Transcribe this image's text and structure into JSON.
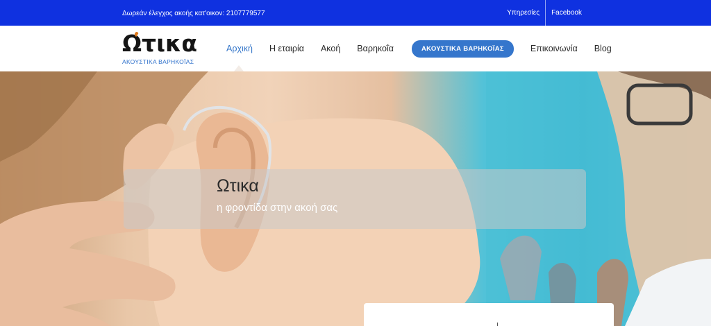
{
  "topbar": {
    "promo": "Δωρεάν έλεγχος ακοής κατ'οικον: 2107779577",
    "links": [
      "Υπηρεσίες",
      "Facebook"
    ]
  },
  "logo": {
    "name": "Ωτικα",
    "subtitle": "ΑΚΟΥΣΤΙΚΑ ΒΑΡΗΚΟΪΑΣ"
  },
  "nav": {
    "items": [
      "Αρχική",
      "Η εταιρία",
      "Ακοή",
      "Βαρηκοΐα"
    ],
    "cta": "ΑΚΟΥΣΤΙΚΑ ΒΑΡΗΚΟΪΑΣ",
    "items_after": [
      "Επικοινωνία",
      "Blog"
    ],
    "active_index": 0
  },
  "hero": {
    "title": "Ωτικα",
    "subtitle": "η φροντίδα στην ακοή σας"
  },
  "colors": {
    "topbar": "#0f31e0",
    "accent": "#3576cc",
    "active_nav": "#3375c9"
  }
}
